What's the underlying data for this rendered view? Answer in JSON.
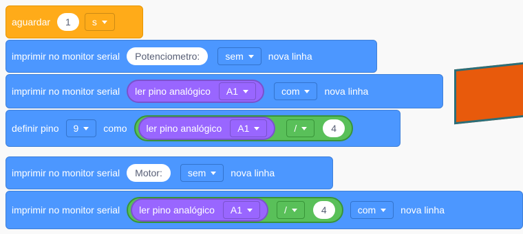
{
  "blocks": {
    "wait": {
      "label": "aguardar",
      "value": "1",
      "unit": "s"
    },
    "print1": {
      "label": "imprimir no monitor serial",
      "text": "Potenciometro:",
      "mode": "sem",
      "suffix": "nova linha"
    },
    "print2": {
      "label": "imprimir no monitor serial",
      "reporter": "ler pino analógico",
      "pin": "A1",
      "mode": "com",
      "suffix": "nova linha"
    },
    "set_pin": {
      "label": "definir pino",
      "pin": "9",
      "as": "como",
      "reporter": "ler pino analógico",
      "analog_pin": "A1",
      "op": "/",
      "divisor": "4"
    },
    "print3": {
      "label": "imprimir no monitor serial",
      "text": "Motor:",
      "mode": "sem",
      "suffix": "nova linha"
    },
    "print4": {
      "label": "imprimir no monitor serial",
      "reporter": "ler pino analógico",
      "pin": "A1",
      "op": "/",
      "divisor": "4",
      "mode": "com",
      "suffix": "nova linha"
    }
  },
  "colors": {
    "motion_blue": "#4c97ff",
    "control_orange": "#ffab19",
    "operator_green": "#59c059",
    "sensing_purple": "#9966ff",
    "annotation_orange": "#e85a0c"
  }
}
